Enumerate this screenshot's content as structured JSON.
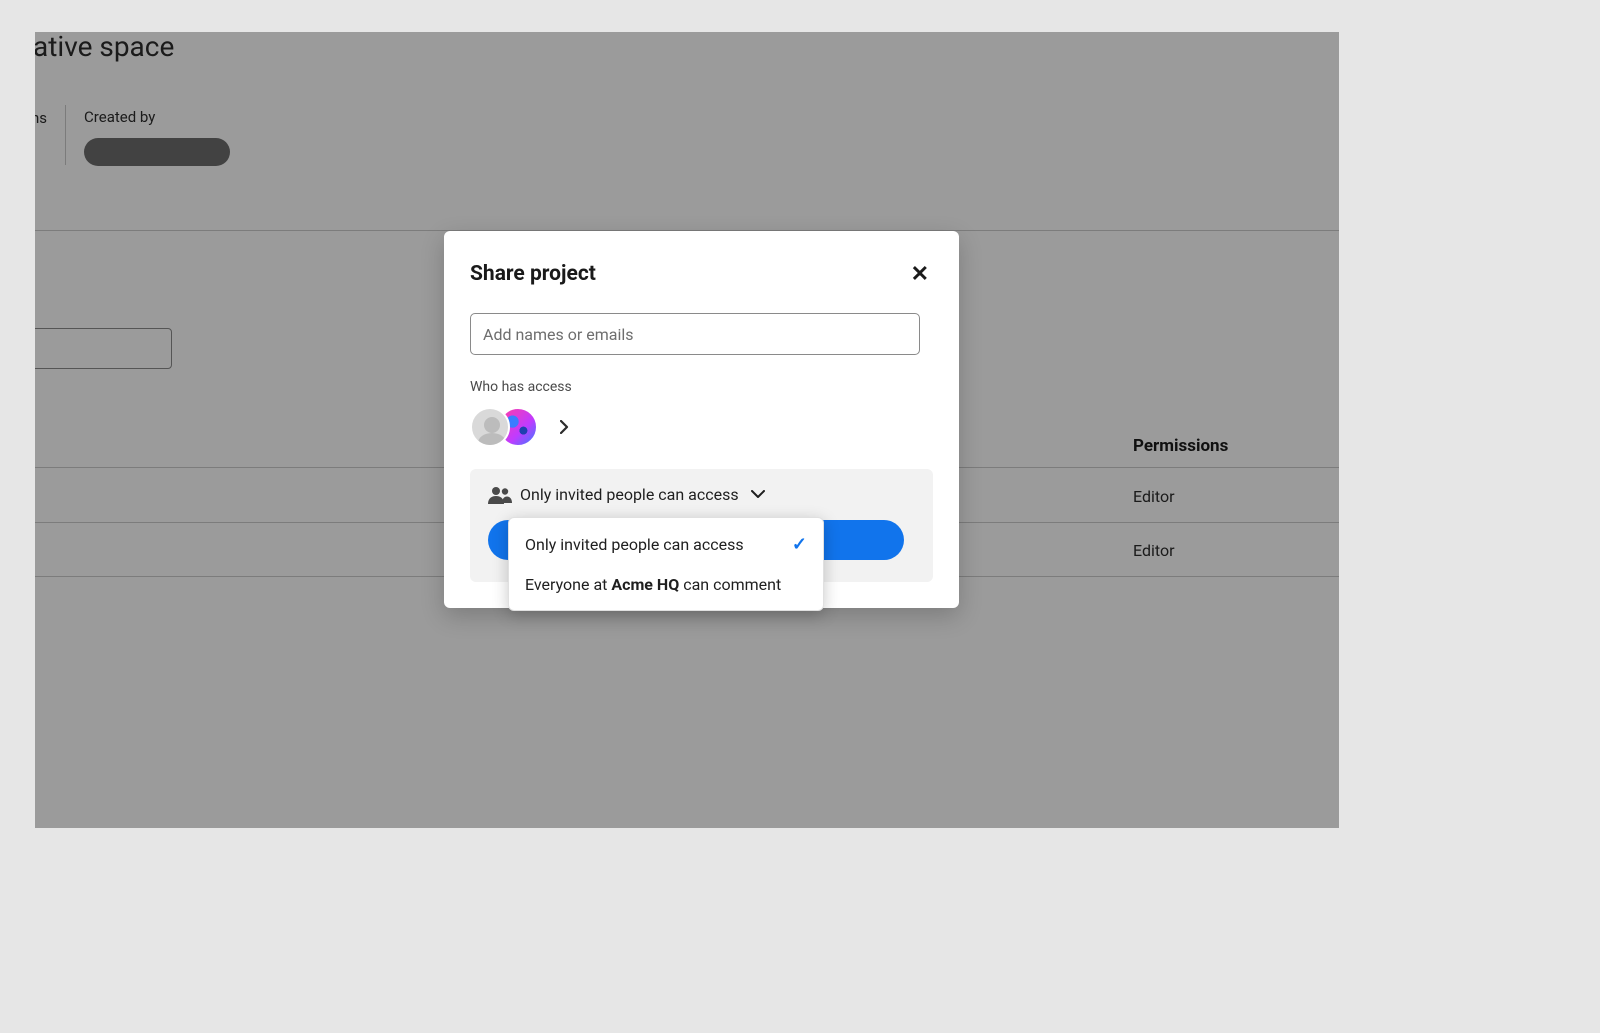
{
  "background": {
    "page_title_fragment": "ative space",
    "meta_left_fragment": "ns",
    "created_by_label": "Created by",
    "permissions_header": "Permissions",
    "rows": [
      {
        "permission": "Editor"
      },
      {
        "permission": "Editor"
      }
    ]
  },
  "modal": {
    "title": "Share project",
    "invite_placeholder": "Add names or emails",
    "who_has_access": "Who has access",
    "access_selector_label": "Only invited people can access",
    "dropdown": {
      "option1": "Only invited people can access",
      "option2_prefix": "Everyone at ",
      "option2_org": "Acme HQ",
      "option2_suffix": " can comment"
    }
  },
  "colors": {
    "primary": "#1174ec"
  }
}
